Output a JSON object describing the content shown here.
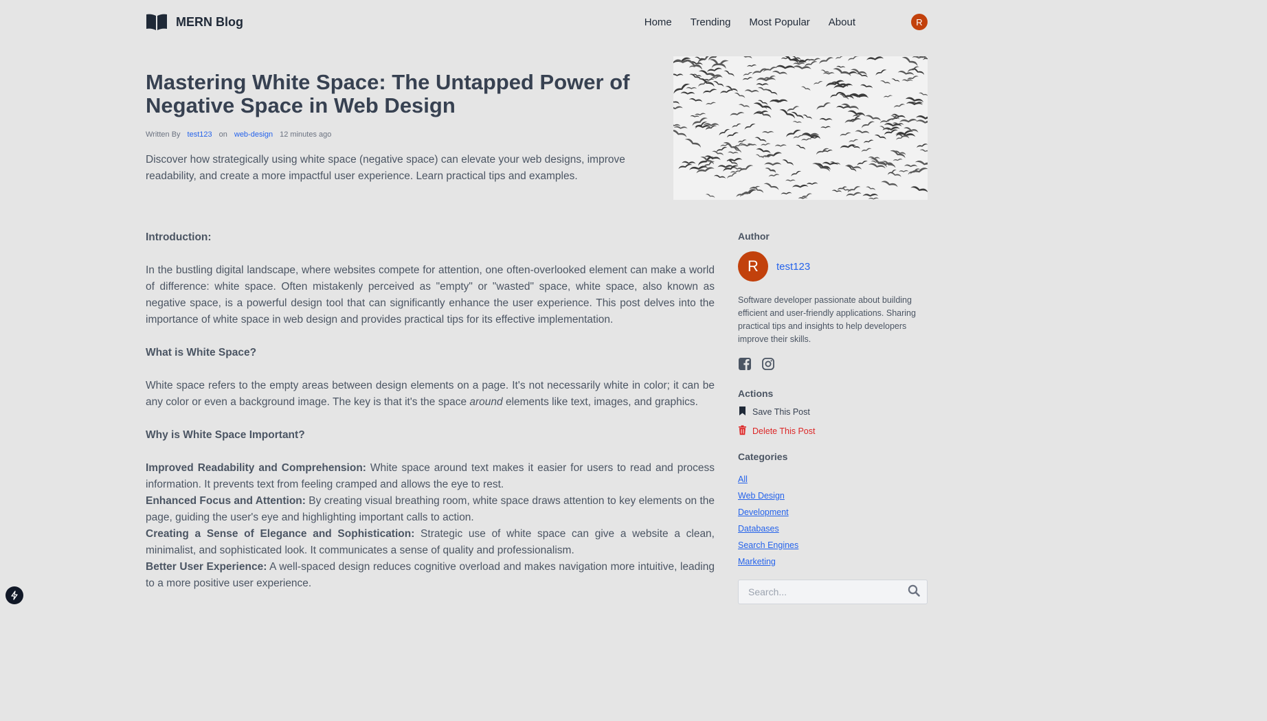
{
  "brand": {
    "name": "MERN Blog",
    "icon": "book-open-icon"
  },
  "nav": {
    "links": [
      "Home",
      "Trending",
      "Most Popular",
      "About"
    ],
    "avatar_initial": "R"
  },
  "post": {
    "title": "Mastering White Space: The Untapped Power of Negative Space in Web Design",
    "meta": {
      "written_by": "Written By",
      "author": "test123",
      "on": "on",
      "category": "web-design",
      "time": "12 minutes ago"
    },
    "description": "Discover how strategically using white space (negative space) can elevate your web designs, improve readability, and create a more impactful user experience. Learn practical tips and examples."
  },
  "content": {
    "intro_heading": "Introduction:",
    "intro_text": "In the bustling digital landscape, where websites compete for attention, one often-overlooked element can make a world of difference: white space. Often mistakenly perceived as \"empty\" or \"wasted\" space, white space, also known as negative space, is a powerful design tool that can significantly enhance the user experience. This post delves into the importance of white space in web design and provides practical tips for its effective implementation.",
    "what_heading": "What is White Space?",
    "what_text_1": "White space refers to the empty areas between design elements on a page. It's not necessarily white in color; it can be any color or even a background image. The key is that it's the space ",
    "what_text_em": "around",
    "what_text_2": " elements like text, images, and graphics.",
    "why_heading": "Why is White Space Important?",
    "items": [
      {
        "bold": "Improved Readability and Comprehension:",
        "text": " White space around text makes it easier for users to read and process information. It prevents text from feeling cramped and allows the eye to rest."
      },
      {
        "bold": "Enhanced Focus and Attention:",
        "text": " By creating visual breathing room, white space draws attention to key elements on the page, guiding the user's eye and highlighting important calls to action."
      },
      {
        "bold": "Creating a Sense of Elegance and Sophistication:",
        "text": " Strategic use of white space can give a website a clean, minimalist, and sophisticated look. It communicates a sense of quality and professionalism."
      },
      {
        "bold": "Better User Experience:",
        "text": " A well-spaced design reduces cognitive overload and makes navigation more intuitive, leading to a more positive user experience."
      }
    ]
  },
  "sidebar": {
    "author_heading": "Author",
    "author_initial": "R",
    "author_name": "test123",
    "bio": "Software developer passionate about building efficient and user-friendly applications. Sharing practical tips and insights to help developers improve their skills.",
    "actions_heading": "Actions",
    "save_label": "Save This Post",
    "delete_label": "Delete This Post",
    "categories_heading": "Categories",
    "categories": [
      "All",
      "Web Design",
      "Development",
      "Databases",
      "Search Engines",
      "Marketing"
    ],
    "search_placeholder": "Search..."
  },
  "colors": {
    "background": "#e5e5e5",
    "link": "#2563eb",
    "avatar": "#c2410c",
    "danger": "#dc2626"
  }
}
